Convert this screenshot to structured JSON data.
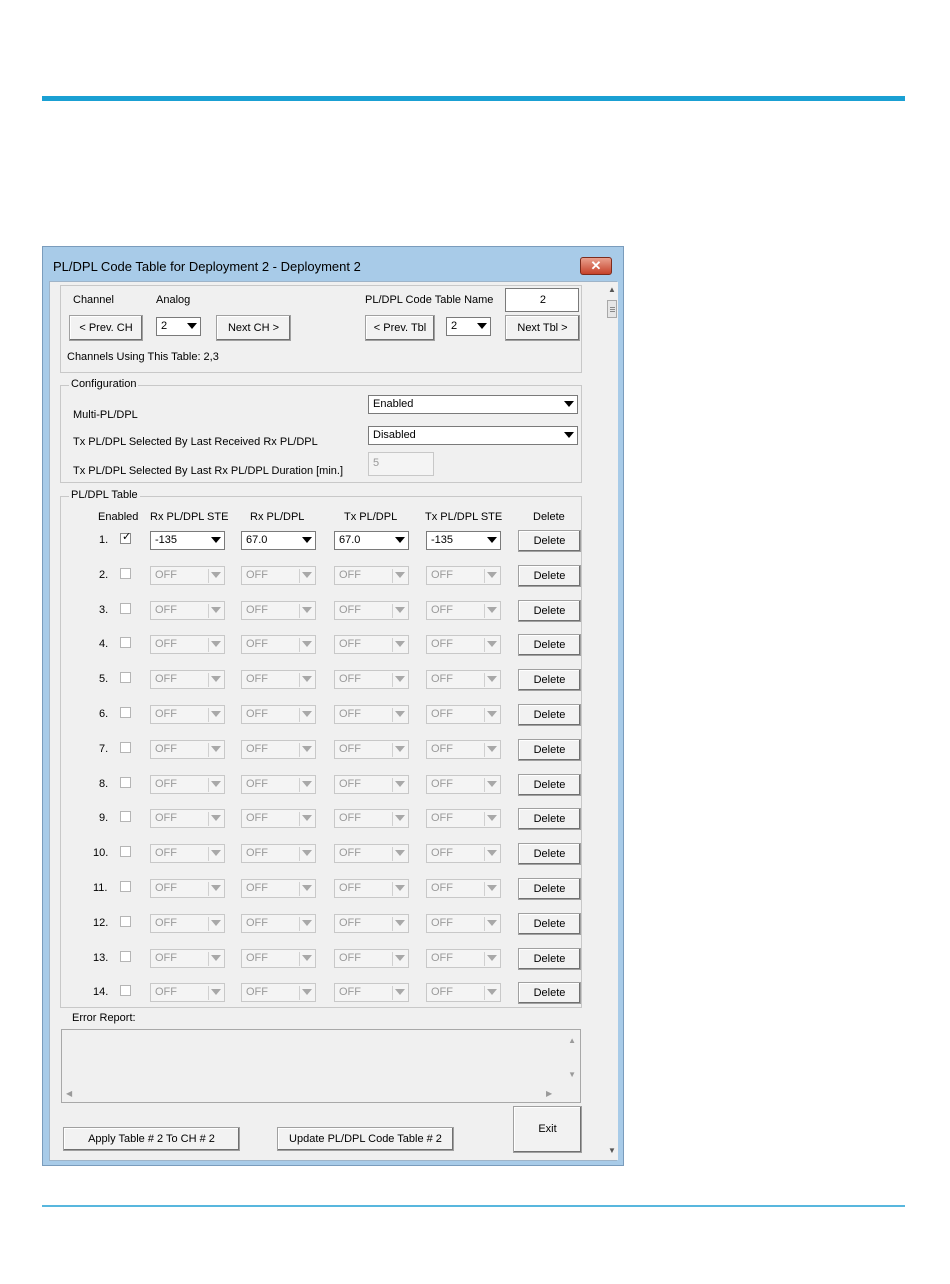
{
  "window": {
    "title": "PL/DPL Code Table for Deployment 2 - Deployment 2",
    "close_glyph": "✕"
  },
  "channel": {
    "label": "Channel",
    "mode": "Analog",
    "prev_label": "< Prev. CH",
    "next_label": "Next CH >",
    "selected": "2",
    "using_text": "Channels Using This Table: 2,3"
  },
  "table_nav": {
    "name_label": "PL/DPL Code Table Name",
    "name_value": "2",
    "prev_label": "< Prev. Tbl",
    "next_label": "Next Tbl >",
    "selected": "2"
  },
  "configuration": {
    "legend": "Configuration",
    "multi_label": "Multi-PL/DPL",
    "multi_value": "Enabled",
    "tx_last_label": "Tx PL/DPL Selected By Last Received Rx PL/DPL",
    "tx_last_value": "Disabled",
    "duration_label": "Tx PL/DPL Selected By Last Rx PL/DPL Duration [min.]",
    "duration_value": "5"
  },
  "pl_table": {
    "legend": "PL/DPL Table",
    "headers": {
      "enabled": "Enabled",
      "rx_ste": "Rx PL/DPL STE",
      "rx": "Rx PL/DPL",
      "tx": "Tx PL/DPL",
      "tx_ste": "Tx PL/DPL STE",
      "delete": "Delete"
    },
    "rows": [
      {
        "num": "1.",
        "enabled": true,
        "rx_ste": "-135",
        "rx": "67.0",
        "tx": "67.0",
        "tx_ste": "-135",
        "delete": "Delete"
      },
      {
        "num": "2.",
        "enabled": false,
        "rx_ste": "OFF",
        "rx": "OFF",
        "tx": "OFF",
        "tx_ste": "OFF",
        "delete": "Delete"
      },
      {
        "num": "3.",
        "enabled": false,
        "rx_ste": "OFF",
        "rx": "OFF",
        "tx": "OFF",
        "tx_ste": "OFF",
        "delete": "Delete"
      },
      {
        "num": "4.",
        "enabled": false,
        "rx_ste": "OFF",
        "rx": "OFF",
        "tx": "OFF",
        "tx_ste": "OFF",
        "delete": "Delete"
      },
      {
        "num": "5.",
        "enabled": false,
        "rx_ste": "OFF",
        "rx": "OFF",
        "tx": "OFF",
        "tx_ste": "OFF",
        "delete": "Delete"
      },
      {
        "num": "6.",
        "enabled": false,
        "rx_ste": "OFF",
        "rx": "OFF",
        "tx": "OFF",
        "tx_ste": "OFF",
        "delete": "Delete"
      },
      {
        "num": "7.",
        "enabled": false,
        "rx_ste": "OFF",
        "rx": "OFF",
        "tx": "OFF",
        "tx_ste": "OFF",
        "delete": "Delete"
      },
      {
        "num": "8.",
        "enabled": false,
        "rx_ste": "OFF",
        "rx": "OFF",
        "tx": "OFF",
        "tx_ste": "OFF",
        "delete": "Delete"
      },
      {
        "num": "9.",
        "enabled": false,
        "rx_ste": "OFF",
        "rx": "OFF",
        "tx": "OFF",
        "tx_ste": "OFF",
        "delete": "Delete"
      },
      {
        "num": "10.",
        "enabled": false,
        "rx_ste": "OFF",
        "rx": "OFF",
        "tx": "OFF",
        "tx_ste": "OFF",
        "delete": "Delete"
      },
      {
        "num": "11.",
        "enabled": false,
        "rx_ste": "OFF",
        "rx": "OFF",
        "tx": "OFF",
        "tx_ste": "OFF",
        "delete": "Delete"
      },
      {
        "num": "12.",
        "enabled": false,
        "rx_ste": "OFF",
        "rx": "OFF",
        "tx": "OFF",
        "tx_ste": "OFF",
        "delete": "Delete"
      },
      {
        "num": "13.",
        "enabled": false,
        "rx_ste": "OFF",
        "rx": "OFF",
        "tx": "OFF",
        "tx_ste": "OFF",
        "delete": "Delete"
      },
      {
        "num": "14.",
        "enabled": false,
        "rx_ste": "OFF",
        "rx": "OFF",
        "tx": "OFF",
        "tx_ste": "OFF",
        "delete": "Delete"
      }
    ]
  },
  "error_report": {
    "label": "Error Report:",
    "value": ""
  },
  "footer": {
    "apply_label": "Apply Table #  2  To CH #  2",
    "update_label": "Update PL/DPL Code Table #  2",
    "exit_label": "Exit"
  },
  "scroll_glyphs": {
    "up": "▲",
    "down": "▼",
    "left": "◀",
    "right": "▶"
  },
  "colors": {
    "accent_rule": "#1aa0d3",
    "window_frame": "#a8cbe8",
    "close_button": "#c6422a"
  }
}
